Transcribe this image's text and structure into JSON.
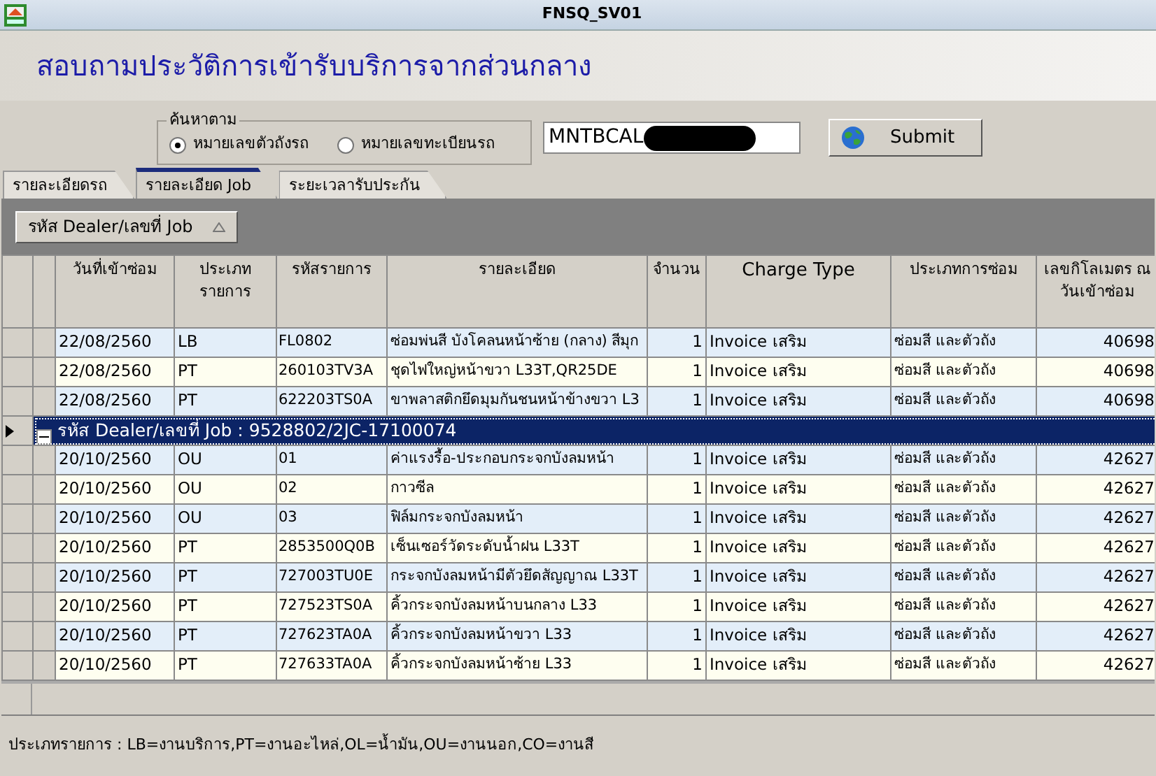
{
  "window": {
    "title": "FNSQ_SV01"
  },
  "heading": "สอบถามประวัติการเข้ารับบริการจากส่วนกลาง",
  "search": {
    "legend": "ค้นหาตาม",
    "options": [
      {
        "label": "หมายเลขตัวถังรถ",
        "selected": true
      },
      {
        "label": "หมายเลขทะเบียนรถ",
        "selected": false
      }
    ],
    "value": "MNTBCAL",
    "redacted": true,
    "button": "Submit"
  },
  "tabs": [
    {
      "label": "รายละเอียดรถ",
      "selected": false
    },
    {
      "label": "รายละเอียด Job",
      "selected": true
    },
    {
      "label": "ระยะเวลารับประกัน",
      "selected": false
    }
  ],
  "group_by": {
    "label": "รหัส Dealer/เลขที่ Job"
  },
  "table": {
    "columns": [
      "วันที่เข้าซ่อม",
      "ประเภท รายการ",
      "รหัสรายการ",
      "รายละเอียด",
      "จำนวน",
      "Charge Type",
      "ประเภทการซ่อม",
      "เลขกิโลเมตร ณ วันเข้าซ่อม"
    ],
    "rows": [
      {
        "kind": "row",
        "cells": [
          "22/08/2560",
          "LB",
          "FL0802",
          "ซ่อมพ่นสี บังโคลนหน้าซ้าย (กลาง) สีมุก",
          "1",
          "Invoice เสริม",
          "ซ่อมสี และตัวถัง",
          "40698"
        ]
      },
      {
        "kind": "row",
        "cells": [
          "22/08/2560",
          "PT",
          "260103TV3A",
          "ชุดไฟใหญ่หน้าขวา L33T,QR25DE",
          "1",
          "Invoice เสริม",
          "ซ่อมสี และตัวถัง",
          "40698"
        ]
      },
      {
        "kind": "row",
        "cells": [
          "22/08/2560",
          "PT",
          "622203TS0A",
          "ขาพลาสติกยึดมุมกันชนหน้าข้างขวา L3",
          "1",
          "Invoice เสริม",
          "ซ่อมสี และตัวถัง",
          "40698"
        ]
      },
      {
        "kind": "group",
        "label": "รหัส Dealer/เลขที่ Job : 9528802/2JC-17100074",
        "expanded": true,
        "selected": true
      },
      {
        "kind": "row",
        "cells": [
          "20/10/2560",
          "OU",
          "01",
          "ค่าแรงรื้อ-ประกอบกระจกบังลมหน้า",
          "1",
          "Invoice เสริม",
          "ซ่อมสี และตัวถัง",
          "42627"
        ]
      },
      {
        "kind": "row",
        "cells": [
          "20/10/2560",
          "OU",
          "02",
          "กาวซีล",
          "1",
          "Invoice เสริม",
          "ซ่อมสี และตัวถัง",
          "42627"
        ]
      },
      {
        "kind": "row",
        "cells": [
          "20/10/2560",
          "OU",
          "03",
          "ฟิล์มกระจกบังลมหน้า",
          "1",
          "Invoice เสริม",
          "ซ่อมสี และตัวถัง",
          "42627"
        ]
      },
      {
        "kind": "row",
        "cells": [
          "20/10/2560",
          "PT",
          "2853500Q0B",
          "เซ็นเซอร์วัดระดับน้ำฝน L33T",
          "1",
          "Invoice เสริม",
          "ซ่อมสี และตัวถัง",
          "42627"
        ]
      },
      {
        "kind": "row",
        "cells": [
          "20/10/2560",
          "PT",
          "727003TU0E",
          "กระจกบังลมหน้ามีตัวยึดสัญญาณ L33T",
          "1",
          "Invoice เสริม",
          "ซ่อมสี และตัวถัง",
          "42627"
        ]
      },
      {
        "kind": "row",
        "cells": [
          "20/10/2560",
          "PT",
          "727523TS0A",
          "คิ้วกระจกบังลมหน้าบนกลาง L33",
          "1",
          "Invoice เสริม",
          "ซ่อมสี และตัวถัง",
          "42627"
        ]
      },
      {
        "kind": "row",
        "cells": [
          "20/10/2560",
          "PT",
          "727623TA0A",
          "คิ้วกระจกบังลมหน้าขวา L33",
          "1",
          "Invoice เสริม",
          "ซ่อมสี และตัวถัง",
          "42627"
        ]
      },
      {
        "kind": "row",
        "cells": [
          "20/10/2560",
          "PT",
          "727633TA0A",
          "คิ้วกระจกบังลมหน้าซ้าย L33",
          "1",
          "Invoice เสริม",
          "ซ่อมสี และตัวถัง",
          "42627"
        ]
      }
    ]
  },
  "legend_note": "ประเภทรายการ : LB=งานบริการ,PT=งานอะไหล่,OL=น้ำมัน,OU=งานนอก,CO=งานสี"
}
